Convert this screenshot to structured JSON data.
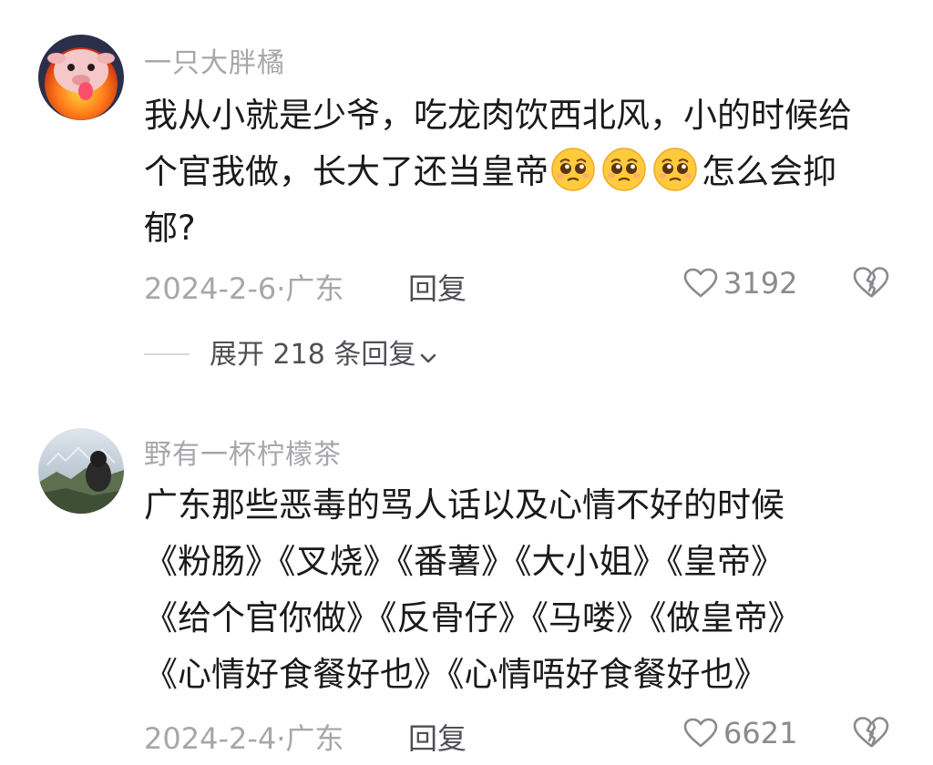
{
  "comments": [
    {
      "username": "一只大胖橘",
      "lines": {
        "l1": "我从小就是少爷，吃龙肉饮西北风，小的时候给",
        "l2_pre": "个官我做，长大了还当皇帝",
        "l2_post": "怎么会抑",
        "l3": "郁?"
      },
      "emoji": "pleading-face-icon",
      "date": "2024-2-6·广东",
      "reply": "回复",
      "likes": "3192",
      "expand": "展开 218 条回复"
    },
    {
      "username": "野有一杯柠檬茶",
      "lines": {
        "l1": "广东那些恶毒的骂人话以及心情不好的时候",
        "l2": "《粉肠》《叉烧》《番薯》《大小姐》《皇帝》",
        "l3": "《给个官你做》《反骨仔》《马喽》《做皇帝》",
        "l4": "《心情好食餐好也》《心情唔好食餐好也》"
      },
      "date": "2024-2-4·广东",
      "reply": "回复",
      "likes": "6621"
    }
  ],
  "colors": {
    "username": "#a7a7ab",
    "body": "#1a1a1a",
    "meta": "#a7a7ab",
    "action": "#4f4f55"
  }
}
